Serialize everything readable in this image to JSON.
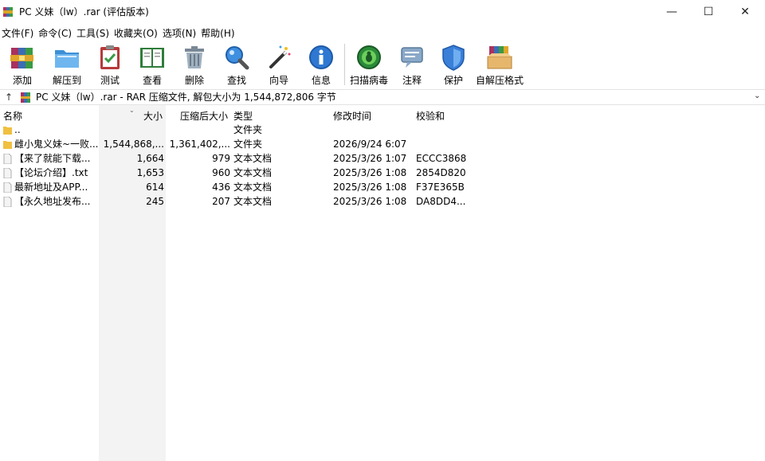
{
  "window": {
    "title": "PC 义妹（lw）.rar (评估版本)",
    "controls": {
      "minimize": "—",
      "maximize": "☐",
      "close": "✕"
    }
  },
  "menu": {
    "items": [
      "文件(F)",
      "命令(C)",
      "工具(S)",
      "收藏夹(O)",
      "选项(N)",
      "帮助(H)"
    ]
  },
  "toolbar": {
    "buttons": [
      {
        "label": "添加",
        "icon": "winrar-add-icon"
      },
      {
        "label": "解压到",
        "icon": "extract-folder-icon"
      },
      {
        "label": "测试",
        "icon": "test-clipboard-icon"
      },
      {
        "label": "查看",
        "icon": "view-book-icon"
      },
      {
        "label": "删除",
        "icon": "trash-icon"
      },
      {
        "label": "查找",
        "icon": "magnifier-icon"
      },
      {
        "label": "向导",
        "icon": "wizard-wand-icon"
      },
      {
        "label": "信息",
        "icon": "info-icon"
      },
      {
        "label": "扫描病毒",
        "icon": "virus-scan-icon"
      },
      {
        "label": "注释",
        "icon": "comment-icon"
      },
      {
        "label": "保护",
        "icon": "shield-icon"
      },
      {
        "label": "自解压格式",
        "icon": "sfx-box-icon"
      }
    ]
  },
  "address": {
    "text": "PC 义妹（lw）.rar - RAR 压缩文件, 解包大小为 1,544,872,806 字节"
  },
  "columns": {
    "name": "名称",
    "size": "大小",
    "packed": "压缩后大小",
    "type": "类型",
    "modified": "修改时间",
    "crc": "校验和"
  },
  "rows": [
    {
      "name": "..",
      "size": "",
      "packed": "",
      "type": "文件夹",
      "modified": "",
      "crc": "",
      "kind": "folder"
    },
    {
      "name": "雌小鬼义妹~一败...",
      "size": "1,544,868,...",
      "packed": "1,361,402,...",
      "type": "文件夹",
      "modified": "2026/9/24 6:07",
      "crc": "",
      "kind": "folder"
    },
    {
      "name": "【来了就能下载...",
      "size": "1,664",
      "packed": "979",
      "type": "文本文档",
      "modified": "2025/3/26 1:07",
      "crc": "ECCC3868",
      "kind": "file"
    },
    {
      "name": "【论坛介绍】.txt",
      "size": "1,653",
      "packed": "960",
      "type": "文本文档",
      "modified": "2025/3/26 1:08",
      "crc": "2854D820",
      "kind": "file"
    },
    {
      "name": "最新地址及APP...",
      "size": "614",
      "packed": "436",
      "type": "文本文档",
      "modified": "2025/3/26 1:08",
      "crc": "F37E365B",
      "kind": "file"
    },
    {
      "name": "【永久地址发布...",
      "size": "245",
      "packed": "207",
      "type": "文本文档",
      "modified": "2025/3/26 1:08",
      "crc": "DA8DD4...",
      "kind": "file"
    }
  ]
}
